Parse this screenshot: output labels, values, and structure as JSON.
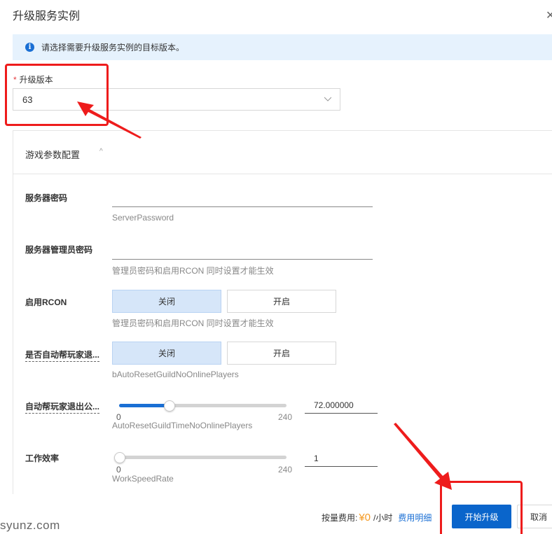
{
  "dialog": {
    "title": "升级服务实例",
    "close_icon": "close-icon"
  },
  "notice": {
    "icon": "info-icon",
    "icon_glyph": "i",
    "text": "请选择需要升级服务实例的目标版本。"
  },
  "version": {
    "required_mark": "*",
    "label": "升级版本",
    "value": "63",
    "dropdown_icon": "chevron-down-icon"
  },
  "game_params": {
    "title": "游戏参数配置",
    "collapse_icon": "chevron-up-icon",
    "collapse_glyph": "^",
    "fields": {
      "server_password": {
        "label": "服务器密码",
        "value": "",
        "hint": "ServerPassword"
      },
      "admin_password": {
        "label": "服务器管理员密码",
        "value": "",
        "hint": "管理员密码和启用RCON 同时设置才能生效"
      },
      "rcon": {
        "label": "启用RCON",
        "options": [
          "关闭",
          "开启"
        ],
        "selected": "关闭",
        "hint": "管理员密码和启用RCON 同时设置才能生效"
      },
      "auto_reset_guild": {
        "label": "是否自动帮玩家退...",
        "options": [
          "关闭",
          "开启"
        ],
        "selected": "关闭",
        "hint": "bAutoResetGuildNoOnlinePlayers"
      },
      "auto_reset_guild_time": {
        "label": "自动帮玩家退出公...",
        "min": 0,
        "max": 240,
        "min_label": "0",
        "max_label": "240",
        "value": 72,
        "value_text": "72.000000",
        "hint": "AutoResetGuildTimeNoOnlinePlayers"
      },
      "work_speed": {
        "label": "工作效率",
        "min": 0,
        "max": 240,
        "min_label": "0",
        "max_label": "240",
        "value": 1,
        "value_text": "1",
        "hint": "WorkSpeedRate"
      }
    }
  },
  "footer": {
    "fee_label": "按量费用:",
    "price": "¥0",
    "unit": "/小时",
    "detail_link": "费用明细",
    "primary_button": "开始升级",
    "cancel_button": "取消"
  },
  "watermark": "syunz.com",
  "colors": {
    "primary": "#0a65cb",
    "notice_bg": "#e6f2fd",
    "price": "#f59a23",
    "segment_selected": "#d6e6f9",
    "annotation": "#ee1c1c"
  }
}
